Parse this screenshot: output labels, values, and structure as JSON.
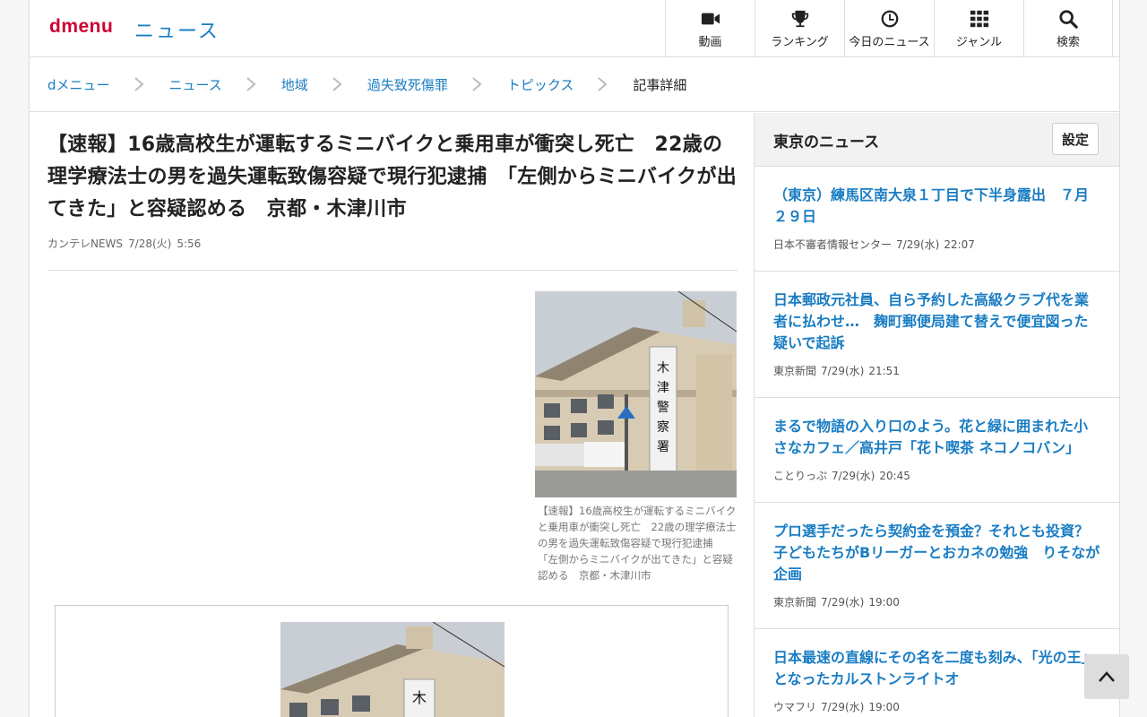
{
  "header": {
    "logo_d": "d",
    "logo_menu": "menu",
    "section_title": "ニュース",
    "nav": [
      {
        "label": "動画",
        "icon": "video-camera-icon"
      },
      {
        "label": "ランキング",
        "icon": "trophy-icon"
      },
      {
        "label": "今日のニュース",
        "icon": "clock-icon"
      },
      {
        "label": "ジャンル",
        "icon": "grid-icon"
      },
      {
        "label": "検索",
        "icon": "search-icon"
      }
    ]
  },
  "breadcrumb": [
    "dメニュー",
    "ニュース",
    "地域",
    "過失致死傷罪",
    "トピックス",
    "記事詳細"
  ],
  "article": {
    "title": "【速報】16歳高校生が運転するミニバイクと乗用車が衝突し死亡　22歳の理学療法士の男を過失運転致傷容疑で現行犯逮捕　「左側からミニバイクが出てきた」と容疑認める　京都・木津川市",
    "source": "カンテレNEWS",
    "date": "7/28(火)",
    "time": "5:56",
    "photo_caption": "【速報】16歳高校生が運転するミニバイクと乗用車が衝突し死亡　22歳の理学療法士の男を過失運転致傷容疑で現行犯逮捕　「左側からミニバイクが出てきた」と容疑認める　京都・木津川市",
    "sign_text": "木津警察署"
  },
  "sidebar": {
    "title": "東京のニュース",
    "settings_label": "設定",
    "items": [
      {
        "title": "（東京）練馬区南大泉１丁目で下半身露出　７月２９日",
        "source": "日本不審者情報センター",
        "date": "7/29(水)",
        "time": "22:07"
      },
      {
        "title": "日本郵政元社員、自ら予約した高級クラブ代を業者に払わせ…　麹町郵便局建て替えで便宜図った疑いで起訴",
        "source": "東京新聞",
        "date": "7/29(水)",
        "time": "21:51"
      },
      {
        "title": "まるで物語の入り口のよう。花と緑に囲まれた小さなカフェ／高井戸「花ト喫茶 ネコノコバン」",
        "source": "ことりっぷ",
        "date": "7/29(水)",
        "time": "20:45"
      },
      {
        "title": "プロ選手だったら契約金を預金？それとも投資？子どもたちがBリーガーとおカネの勉強　りそなが企画",
        "source": "東京新聞",
        "date": "7/29(水)",
        "time": "19:00"
      },
      {
        "title": "日本最速の直線にその名を二度も刻み、「光の王」となったカルストンライトオ",
        "source": "ウマフリ",
        "date": "7/29(水)",
        "time": "19:00"
      }
    ]
  }
}
